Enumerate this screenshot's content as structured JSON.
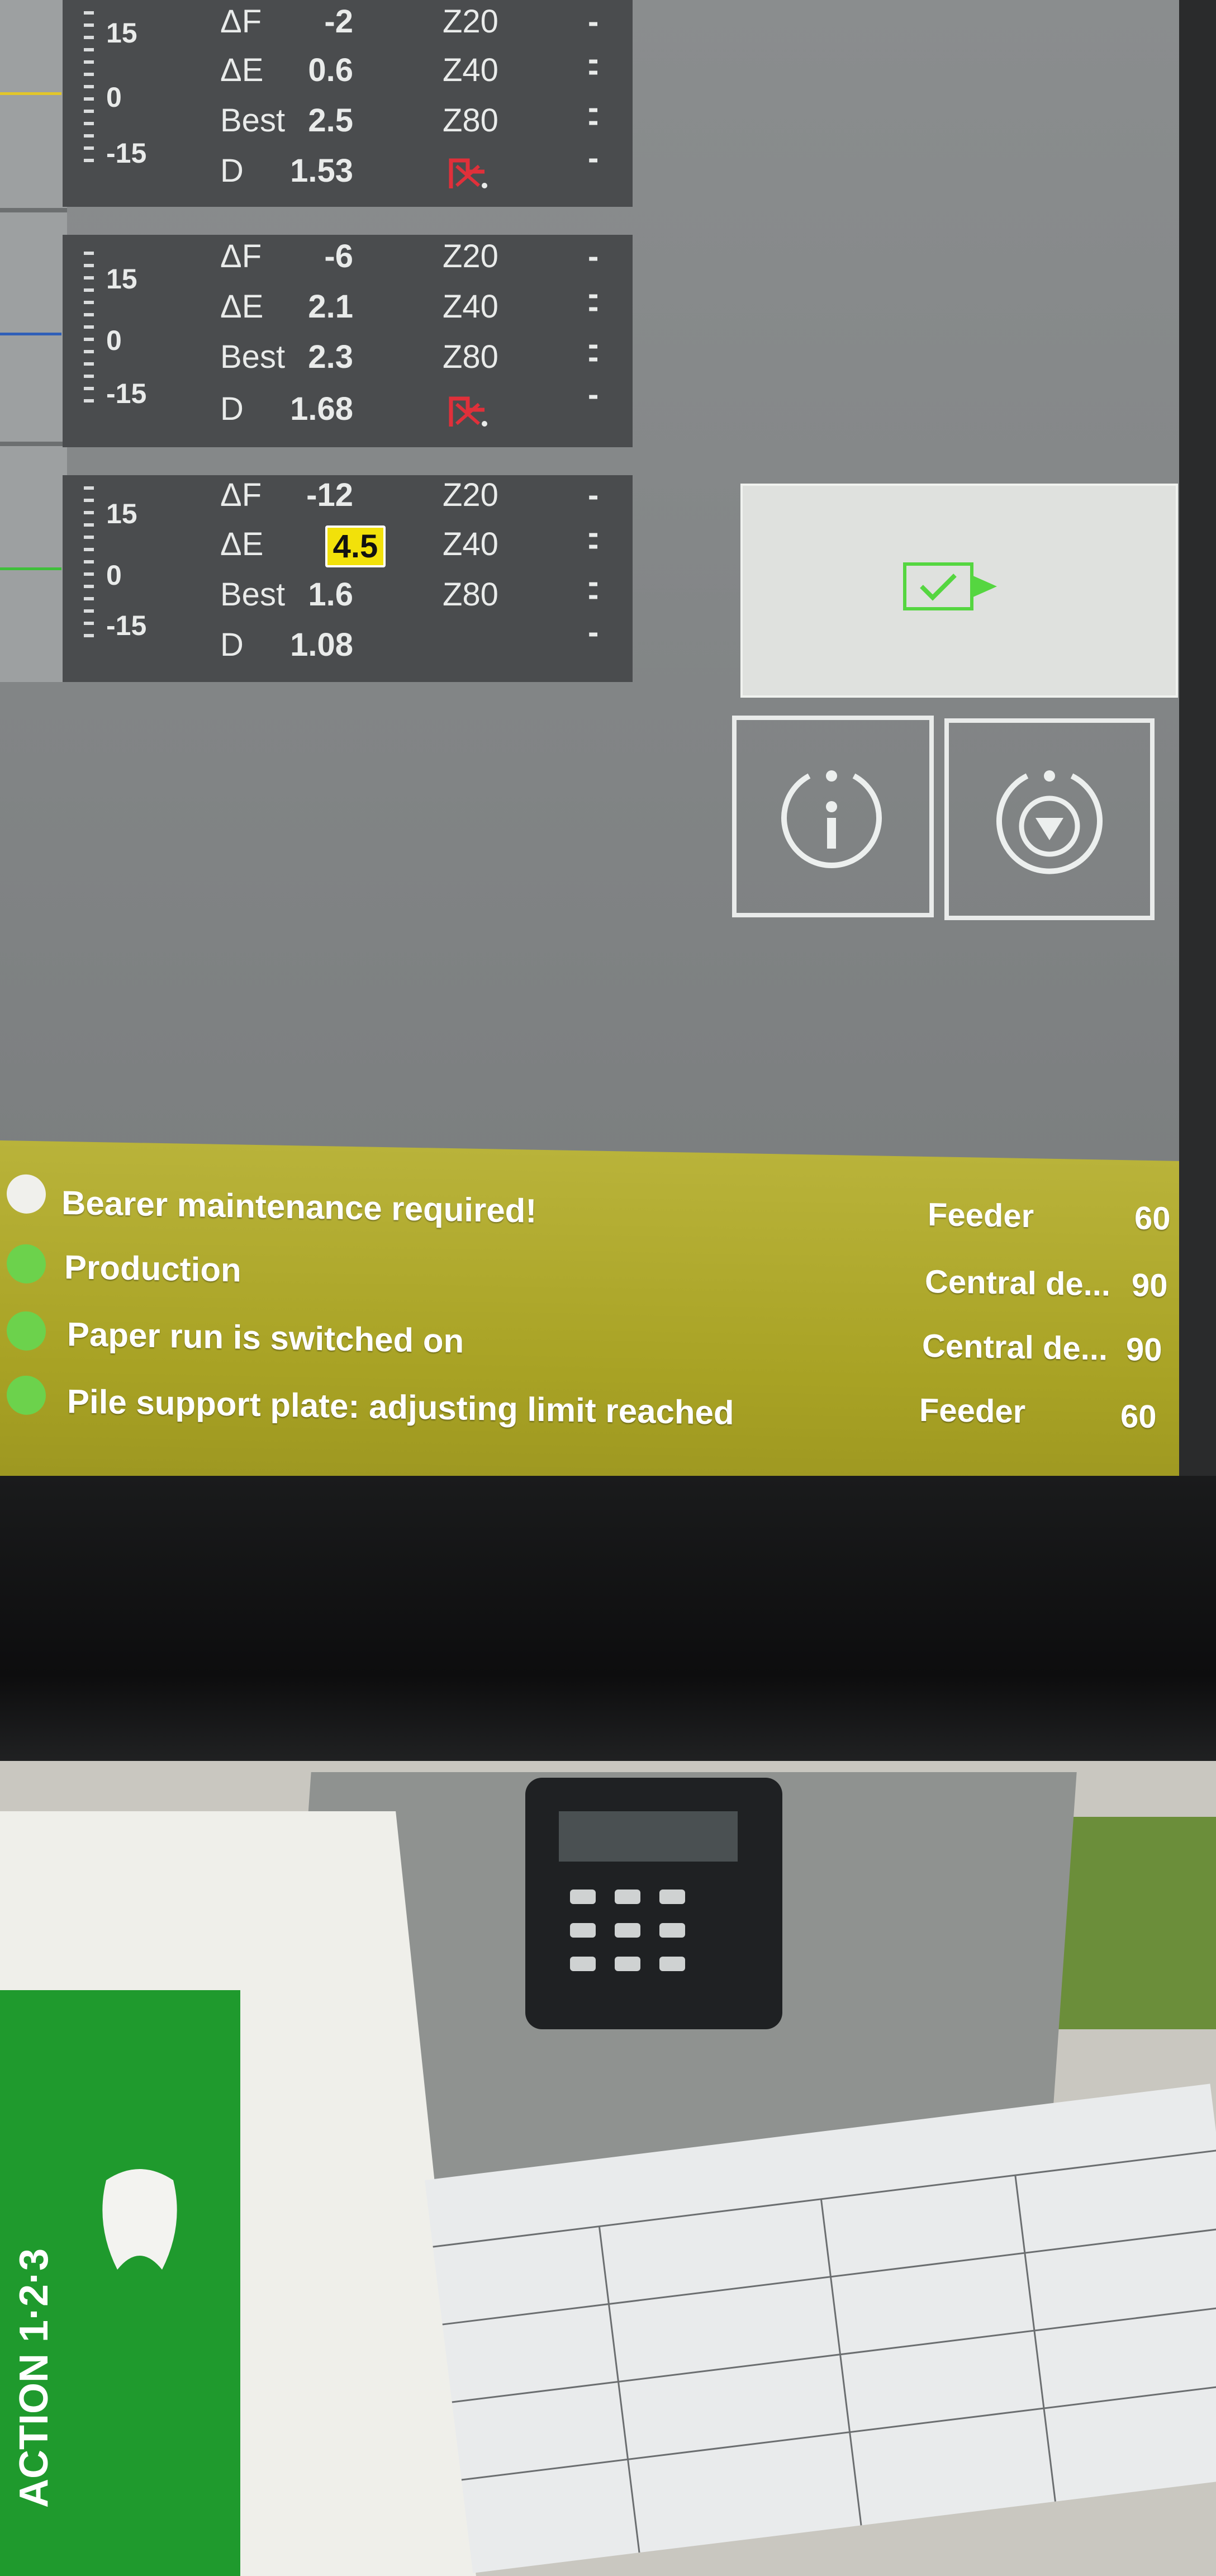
{
  "panels": [
    {
      "scale": [
        "15",
        "0",
        "-15"
      ],
      "rows": [
        {
          "label": "ΔF",
          "value": "-2",
          "zone": "Z20",
          "dash": "--"
        },
        {
          "label": "ΔE",
          "value": "0.6",
          "zone": "Z40",
          "dash": "--"
        },
        {
          "label": "Best",
          "value": "2.5",
          "zone": "Z80",
          "dash": "--"
        },
        {
          "label": "D",
          "value": "1.53",
          "zone": "",
          "dash": ""
        }
      ]
    },
    {
      "scale": [
        "15",
        "0",
        "-15"
      ],
      "rows": [
        {
          "label": "ΔF",
          "value": "-6",
          "zone": "Z20",
          "dash": "--"
        },
        {
          "label": "ΔE",
          "value": "2.1",
          "zone": "Z40",
          "dash": "--"
        },
        {
          "label": "Best",
          "value": "2.3",
          "zone": "Z80",
          "dash": "--"
        },
        {
          "label": "D",
          "value": "1.68",
          "zone": "",
          "dash": ""
        }
      ]
    },
    {
      "scale": [
        "15",
        "0",
        "-15"
      ],
      "rows": [
        {
          "label": "ΔF",
          "value": "-12",
          "zone": "Z20",
          "dash": "--"
        },
        {
          "label": "ΔE",
          "value": "4.5",
          "zone": "Z40",
          "dash": "--"
        },
        {
          "label": "Best",
          "value": "1.6",
          "zone": "Z80",
          "dash": "--"
        },
        {
          "label": "D",
          "value": "1.08",
          "zone": "",
          "dash": ""
        }
      ]
    }
  ],
  "messages": [
    {
      "text": "Bearer maintenance required!",
      "source": "Feeder",
      "code": "60"
    },
    {
      "text": "Production",
      "source": "Central de...",
      "code": "90"
    },
    {
      "text": "Paper run is switched on",
      "source": "Central de...",
      "code": "90"
    },
    {
      "text": "Pile support plate: adjusting limit reached",
      "source": "Feeder",
      "code": "60"
    }
  ],
  "colors": {
    "highlight": "#f2e10a",
    "message_bar": "#b0aa2c",
    "status_ok": "#6cd24c",
    "warning_red": "#e0303a"
  },
  "background_product": {
    "box_text": "ACTION 1·2·3"
  }
}
